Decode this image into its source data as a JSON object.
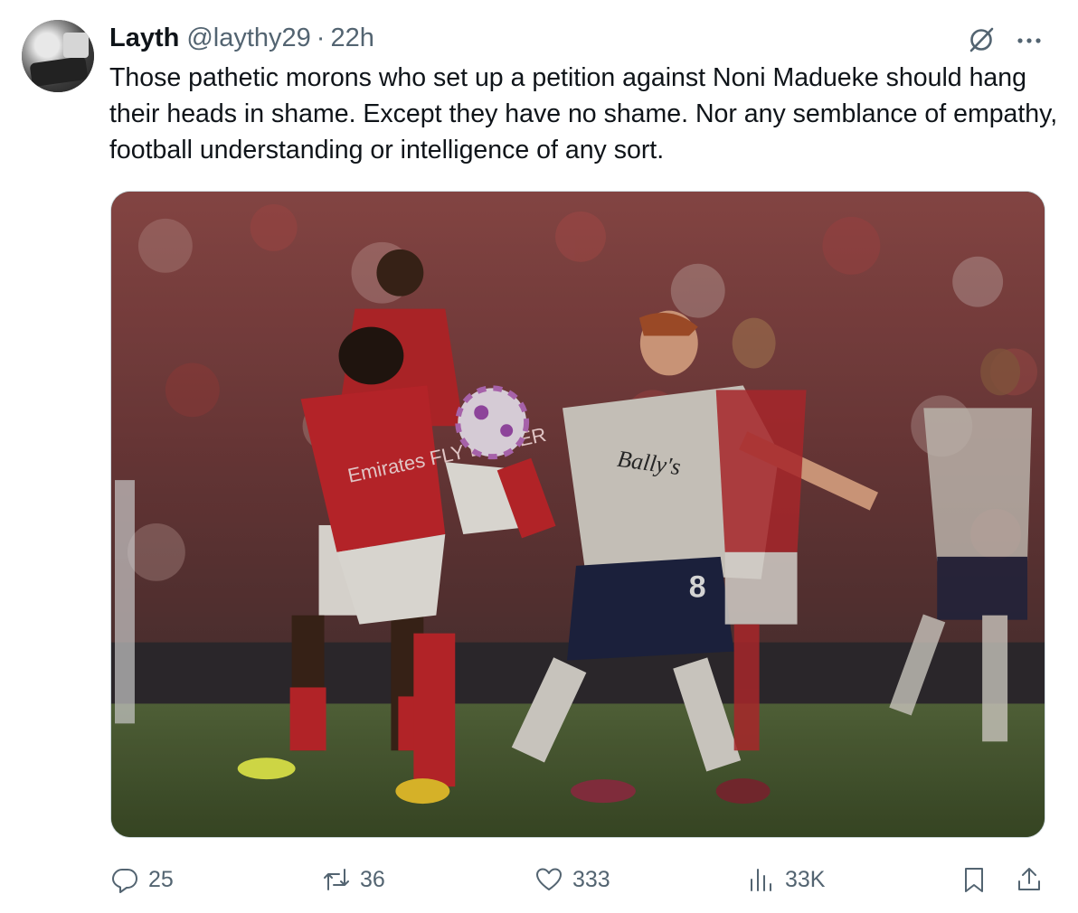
{
  "tweet": {
    "author_name": "Layth",
    "author_handle": "@laythy29",
    "separator": "·",
    "time": "22h",
    "text": "Those pathetic morons who set up a petition against Noni Madueke should hang their heads in shame. Except they have no shame. Nor any semblance of empathy, football understanding or intelligence of any sort.",
    "media": {
      "shirt_sponsor_left": "Emirates FLY BETTER",
      "shirt_sponsor_right": "Bally's",
      "shirt_number": "8"
    }
  },
  "actions": {
    "replies": "25",
    "reposts": "36",
    "likes": "333",
    "views": "33K"
  },
  "icons": {
    "grok": "grok-icon",
    "more": "more-icon",
    "reply": "reply-icon",
    "repost": "repost-icon",
    "like": "heart-icon",
    "views": "views-icon",
    "bookmark": "bookmark-icon",
    "share": "share-icon"
  },
  "colors": {
    "text": "#0f1419",
    "secondary": "#536471",
    "border": "#cfd9de"
  }
}
